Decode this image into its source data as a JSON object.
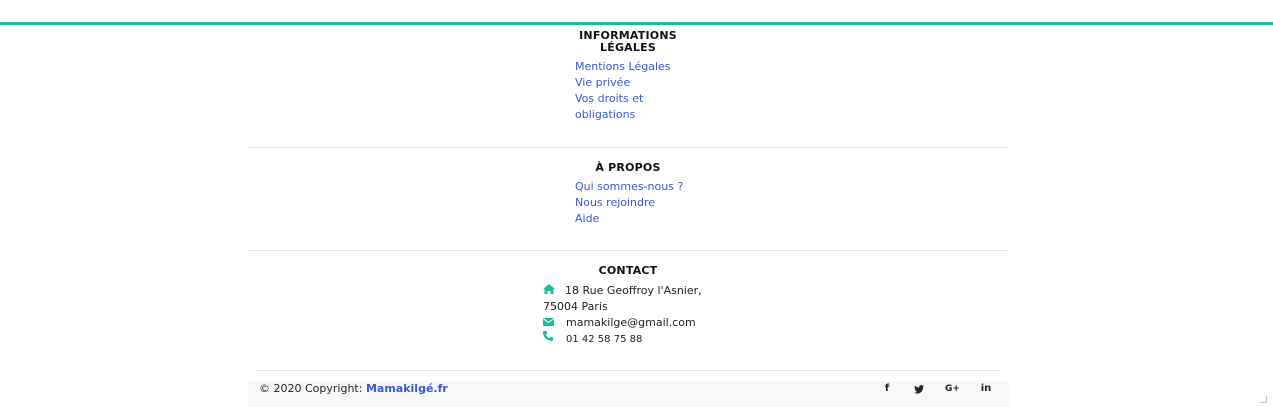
{
  "legal": {
    "heading_line1": "INFORMATIONS",
    "heading_line2": "LÉGALES",
    "links": [
      "Mentions Légales",
      "Vie privée",
      "Vos droits et",
      "obligations"
    ]
  },
  "about": {
    "heading": "À PROPOS",
    "links": [
      "Qui sommes-nous ?",
      "Nous rejoindre",
      "Aide"
    ]
  },
  "contact": {
    "heading": "CONTACT",
    "address_line1": "18 Rue Geoffroy l'Asnier,",
    "address_line2": "75004 Paris",
    "email": "mamakilge@gmail.com",
    "phone": "01 42 58 75 88",
    "icons": [
      "home-icon",
      "envelope-icon",
      "phone-icon"
    ]
  },
  "footer": {
    "copyright_prefix": "© 2020 Copyright: ",
    "brand": "Mamakilgé.fr",
    "social": [
      {
        "label": "f",
        "icon": "facebook-icon"
      },
      {
        "label": "t",
        "icon": "twitter-icon"
      },
      {
        "label": "G+",
        "icon": "google-plus-icon"
      },
      {
        "label": "in",
        "icon": "linkedin-icon"
      }
    ]
  },
  "colors": {
    "accent": "#1bbc9b",
    "link": "#3a57d6"
  }
}
